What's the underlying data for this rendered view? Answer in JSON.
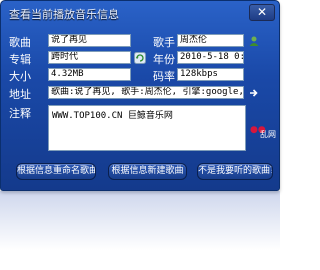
{
  "window": {
    "title": "查看当前播放音乐信息",
    "close_glyph": "✕"
  },
  "fields": {
    "song": {
      "label": "歌曲",
      "value": "说了再见"
    },
    "artist": {
      "label": "歌手",
      "value": "周杰伦"
    },
    "album": {
      "label": "专辑",
      "value": "跨时代"
    },
    "year": {
      "label": "年份",
      "value": "2010-5-18 0:00"
    },
    "size": {
      "label": "大小",
      "value": "4.32MB"
    },
    "bitrate": {
      "label": "码率",
      "value": "128kbps"
    },
    "address": {
      "label": "地址",
      "value": "歌曲:说了再见, 歌手:周杰伦, 引擎:google, 来源"
    },
    "notes": {
      "label": "注释",
      "value": "WWW.TOP100.CN 巨鲸音乐网"
    }
  },
  "logo": {
    "dots": "●●",
    "text": "乱网"
  },
  "buttons": {
    "rename": "根据信息重命名歌曲",
    "new_song": "根据信息新建歌曲",
    "not_wanted": "不是我要听的歌曲？"
  }
}
